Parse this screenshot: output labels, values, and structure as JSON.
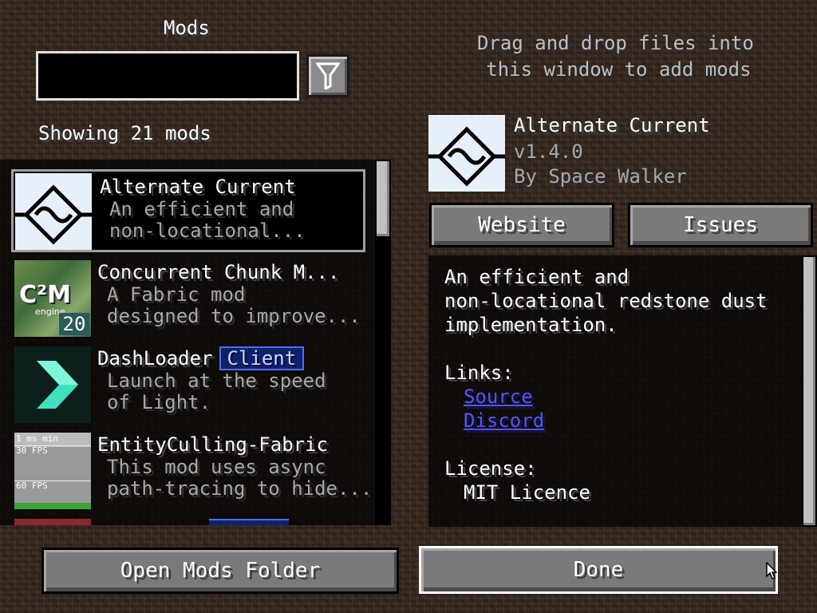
{
  "screen_title": "Mods",
  "search": {
    "value": "",
    "placeholder": ""
  },
  "filter_icon": "filter-funnel-icon",
  "showing_text": "Showing 21 mods",
  "drop_hint": {
    "line1": "Drag and drop files into",
    "line2": "this window to add mods"
  },
  "mods": [
    {
      "name": "Alternate Current",
      "desc1": "An efficient and",
      "desc2": "non-locational...",
      "badge": "",
      "icon": "alternate-current-icon",
      "selected": true
    },
    {
      "name": "Concurrent Chunk M...",
      "desc1": "A Fabric mod",
      "desc2": "designed to improve...",
      "badge": "",
      "icon": "c2me-icon",
      "icon_text_main": "C²M",
      "icon_text_sub": "engine",
      "icon_text_num": "20"
    },
    {
      "name": "DashLoader",
      "desc1": "Launch at the speed",
      "desc2": "of Light.",
      "badge": "Client",
      "icon": "dashloader-icon"
    },
    {
      "name": "EntityCulling-Fabric",
      "desc1": "This mod uses async",
      "desc2": "path-tracing to hide...",
      "badge": "",
      "icon": "entityculling-icon",
      "icon_text_1": "1 ms min",
      "icon_text_2": "30 FPS",
      "icon_text_3": "60 FPS"
    }
  ],
  "detail": {
    "name": "Alternate Current",
    "version": "v1.4.0",
    "author": "By Space Walker",
    "website_label": "Website",
    "issues_label": "Issues",
    "desc_line1": "An efficient and",
    "desc_line2": "non-locational redstone dust",
    "desc_line3": "implementation.",
    "links_label": "Links:",
    "links": [
      "Source",
      "Discord"
    ],
    "license_label": "License:",
    "license": "MIT Licence"
  },
  "buttons": {
    "open_folder": "Open Mods Folder",
    "done": "Done"
  },
  "colors": {
    "badge_bg": "#10206a",
    "badge_border": "#4d6ff0",
    "link": "#5555ff"
  }
}
